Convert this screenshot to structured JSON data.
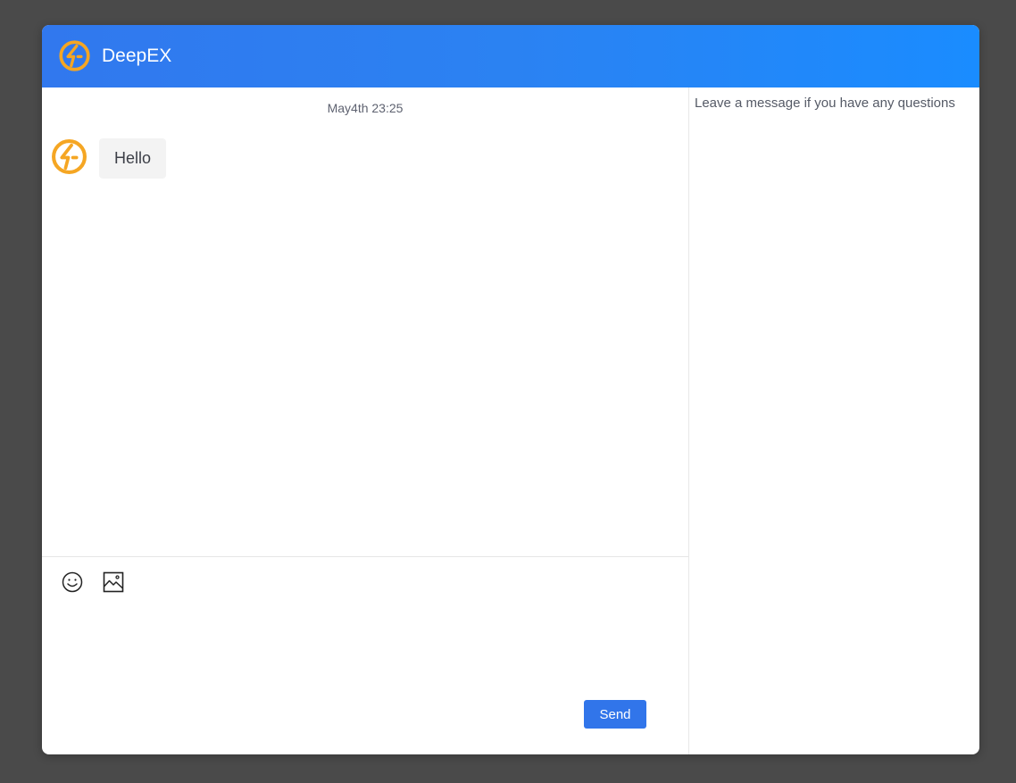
{
  "header": {
    "title": "DeepEX",
    "logo_icon": "deepex-logo-icon",
    "background_from": "#3178ee",
    "background_to": "#1a8cff"
  },
  "chat": {
    "timestamp": "May4th 23:25",
    "messages": [
      {
        "sender_avatar": "deepex-logo-icon",
        "text": "Hello"
      }
    ]
  },
  "composer": {
    "emoji_icon": "smiley-icon",
    "image_icon": "image-icon",
    "input_value": "",
    "input_placeholder": "",
    "send_label": "Send",
    "send_color": "#3175ea"
  },
  "side_panel": {
    "note": "Leave a message if you have any questions"
  },
  "colors": {
    "logo": "#f5a623",
    "backdrop": "#4a4a4a"
  }
}
